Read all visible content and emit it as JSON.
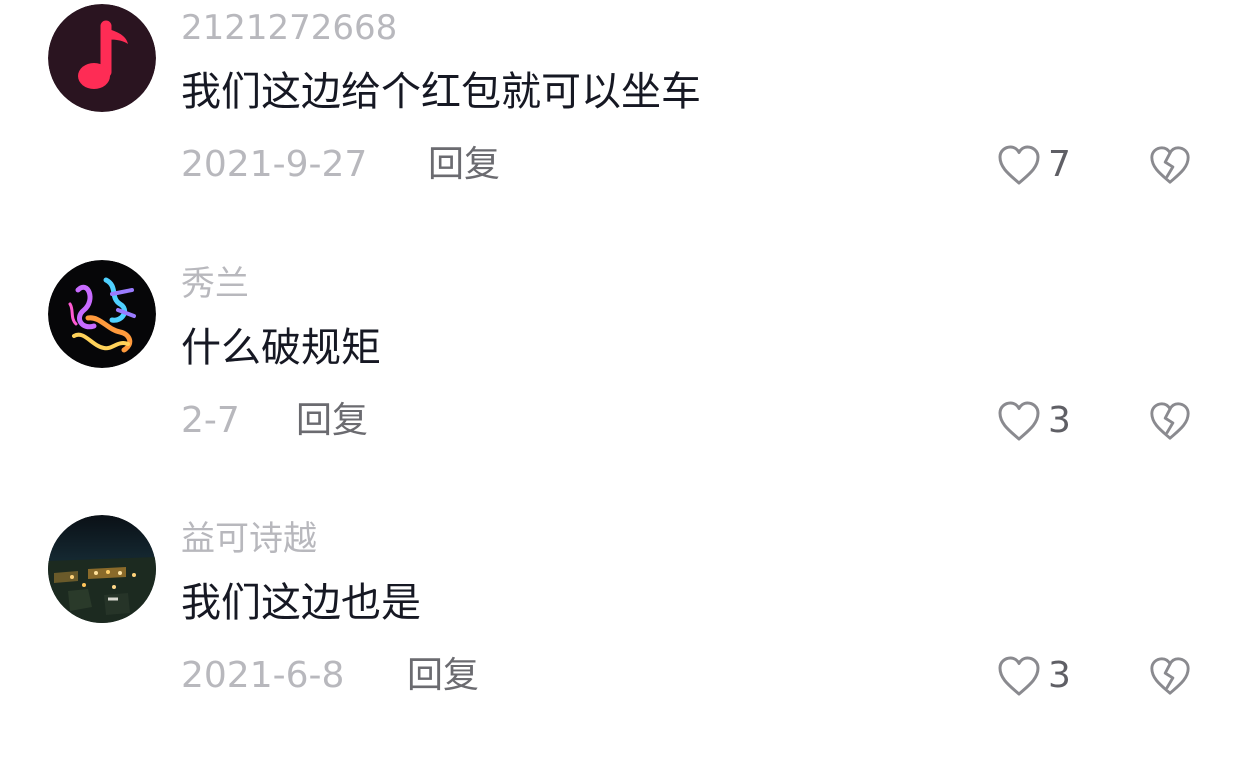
{
  "comments": [
    {
      "username": "2121272668",
      "text": "我们这边给个红包就可以坐车",
      "date": "2021-9-27",
      "reply_label": "回复",
      "likes": "7",
      "avatar_icon": "music-note-icon",
      "avatar_colors": {
        "bg": "#2a1420",
        "note": "#fe2c55"
      }
    },
    {
      "username": "秀兰",
      "text": "什么破规矩",
      "date": "2-7",
      "reply_label": "回复",
      "likes": "3",
      "avatar_icon": "neon-calligraphy-avatar",
      "avatar_colors": {
        "bg": "#060608"
      }
    },
    {
      "username": "益可诗越",
      "text": "我们这边也是",
      "date": "2021-6-8",
      "reply_label": "回复",
      "likes": "3",
      "avatar_icon": "night-city-avatar",
      "avatar_colors": {
        "bg": "#101a22"
      }
    }
  ],
  "icons": {
    "like": "heart-outline-icon",
    "dislike": "broken-heart-icon"
  },
  "colors": {
    "username": "#b8b8bd",
    "text": "#161823",
    "meta": "#b8b8bd",
    "reply": "#6b6b70",
    "icon": "#8a8a8f"
  }
}
